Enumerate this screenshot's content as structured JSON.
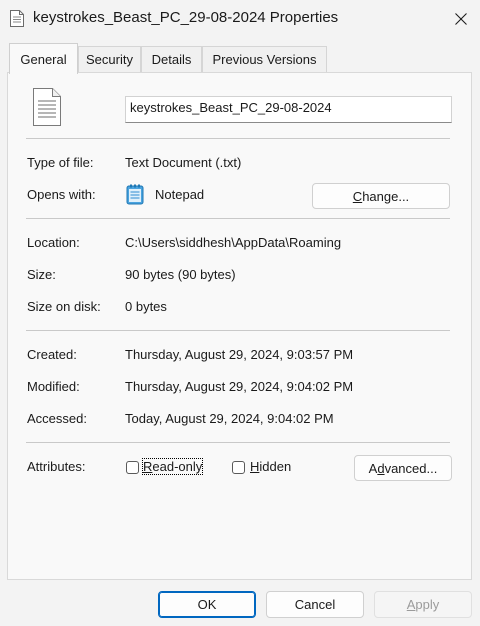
{
  "window": {
    "title": "keystrokes_Beast_PC_29-08-2024 Properties",
    "icons": {
      "file": "text-file-icon",
      "close": "close-icon",
      "notepad": "notepad-icon"
    }
  },
  "tabs": [
    {
      "label": "General",
      "active": true
    },
    {
      "label": "Security",
      "active": false
    },
    {
      "label": "Details",
      "active": false
    },
    {
      "label": "Previous Versions",
      "active": false
    }
  ],
  "general": {
    "filename": "keystrokes_Beast_PC_29-08-2024",
    "type_label": "Type of file:",
    "type_value": "Text Document (.txt)",
    "opens_label": "Opens with:",
    "opens_value": "Notepad",
    "change_button": {
      "before": "",
      "underline": "C",
      "after": "hange..."
    },
    "location_label": "Location:",
    "location_value": "C:\\Users\\siddhesh\\AppData\\Roaming",
    "size_label": "Size:",
    "size_value": "90 bytes (90 bytes)",
    "size_disk_label": "Size on disk:",
    "size_disk_value": "0 bytes",
    "created_label": "Created:",
    "created_value": "Thursday, August 29, 2024, 9:03:57 PM",
    "modified_label": "Modified:",
    "modified_value": "Thursday, August 29, 2024, 9:04:02 PM",
    "accessed_label": "Accessed:",
    "accessed_value": "Today, August 29, 2024, 9:04:02 PM",
    "attributes_label": "Attributes:",
    "readonly": {
      "before": "",
      "underline": "R",
      "after": "ead-only",
      "checked": false
    },
    "hidden": {
      "before": "",
      "underline": "H",
      "after": "idden",
      "checked": false
    },
    "advanced_button": {
      "before": "A",
      "underline": "d",
      "after": "vanced..."
    }
  },
  "footer": {
    "ok": "OK",
    "cancel": "Cancel",
    "apply": {
      "before": "",
      "underline": "A",
      "after": "pply"
    }
  }
}
